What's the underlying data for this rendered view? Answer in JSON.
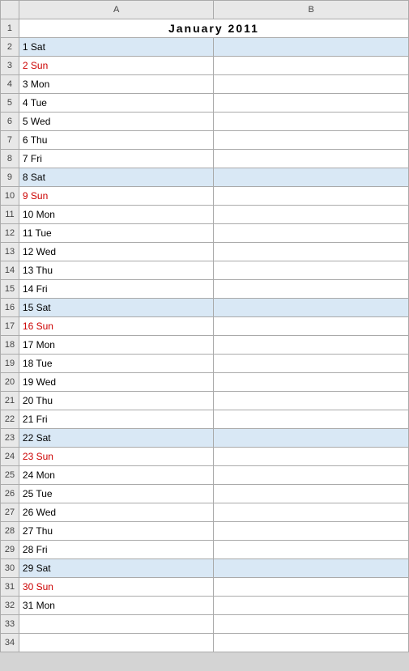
{
  "title": "January   2011",
  "columns": {
    "row_num_header": "",
    "col_a_header": "A",
    "col_b_header": "B"
  },
  "rows": [
    {
      "num": "1",
      "label": "",
      "type": "title",
      "rowNum": "1"
    },
    {
      "num": "2",
      "label": "1 Sat",
      "type": "sat",
      "rowNum": "2"
    },
    {
      "num": "3",
      "label": "2 Sun",
      "type": "sun",
      "rowNum": "3"
    },
    {
      "num": "4",
      "label": "3 Mon",
      "type": "normal",
      "rowNum": "4"
    },
    {
      "num": "5",
      "label": "4 Tue",
      "type": "normal",
      "rowNum": "5"
    },
    {
      "num": "6",
      "label": "5 Wed",
      "type": "normal",
      "rowNum": "6"
    },
    {
      "num": "7",
      "label": "6 Thu",
      "type": "normal",
      "rowNum": "7"
    },
    {
      "num": "8",
      "label": "7 Fri",
      "type": "normal",
      "rowNum": "8"
    },
    {
      "num": "9",
      "label": "8 Sat",
      "type": "sat",
      "rowNum": "9"
    },
    {
      "num": "10",
      "label": "9 Sun",
      "type": "sun",
      "rowNum": "10"
    },
    {
      "num": "11",
      "label": "10 Mon",
      "type": "normal",
      "rowNum": "11"
    },
    {
      "num": "12",
      "label": "11 Tue",
      "type": "normal",
      "rowNum": "12"
    },
    {
      "num": "13",
      "label": "12 Wed",
      "type": "normal",
      "rowNum": "13"
    },
    {
      "num": "14",
      "label": "13 Thu",
      "type": "normal",
      "rowNum": "14"
    },
    {
      "num": "15",
      "label": "14 Fri",
      "type": "normal",
      "rowNum": "15"
    },
    {
      "num": "16",
      "label": "15 Sat",
      "type": "sat",
      "rowNum": "16"
    },
    {
      "num": "17",
      "label": "16 Sun",
      "type": "sun",
      "rowNum": "17"
    },
    {
      "num": "18",
      "label": "17 Mon",
      "type": "normal",
      "rowNum": "18"
    },
    {
      "num": "19",
      "label": "18 Tue",
      "type": "normal",
      "rowNum": "19"
    },
    {
      "num": "20",
      "label": "19 Wed",
      "type": "normal",
      "rowNum": "20"
    },
    {
      "num": "21",
      "label": "20 Thu",
      "type": "normal",
      "rowNum": "21"
    },
    {
      "num": "22",
      "label": "21 Fri",
      "type": "normal",
      "rowNum": "22"
    },
    {
      "num": "23",
      "label": "22 Sat",
      "type": "sat",
      "rowNum": "23"
    },
    {
      "num": "24",
      "label": "23 Sun",
      "type": "sun",
      "rowNum": "24"
    },
    {
      "num": "25",
      "label": "24 Mon",
      "type": "normal",
      "rowNum": "25"
    },
    {
      "num": "26",
      "label": "25 Tue",
      "type": "normal",
      "rowNum": "26"
    },
    {
      "num": "27",
      "label": "26 Wed",
      "type": "normal",
      "rowNum": "27"
    },
    {
      "num": "28",
      "label": "27 Thu",
      "type": "normal",
      "rowNum": "28"
    },
    {
      "num": "29",
      "label": "28 Fri",
      "type": "normal",
      "rowNum": "29"
    },
    {
      "num": "30",
      "label": "29 Sat",
      "type": "sat",
      "rowNum": "30"
    },
    {
      "num": "31",
      "label": "30 Sun",
      "type": "sun",
      "rowNum": "31"
    },
    {
      "num": "32",
      "label": "31 Mon",
      "type": "normal",
      "rowNum": "32"
    },
    {
      "num": "33",
      "label": "",
      "type": "empty",
      "rowNum": "33"
    },
    {
      "num": "34",
      "label": "",
      "type": "empty",
      "rowNum": "34"
    }
  ]
}
